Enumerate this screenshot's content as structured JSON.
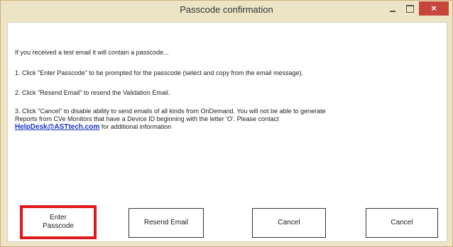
{
  "window": {
    "title": "Passcode confirmation",
    "close_glyph": "×"
  },
  "message": {
    "intro": "If you received a test email it will contain a passcode...",
    "step1": "1. Click \"Enter Passcode\" to be prompted for the passcode (select and copy from the email message).",
    "step2": "2. Click \"Resend Email\" to resend the Validation Email.",
    "step3_line1": "3. Click \"Cancel\" to disable ability to send emails of all kinds from OnDemand. You will not be able to generate",
    "step3_line2": "Reports from CVe Monitors that have a Device ID beginning with the letter 'O'. Please contact",
    "email_link": "HelpDesk@ASTtech.com",
    "step3_line3": " for additional information"
  },
  "buttons": {
    "enter_passcode_line1": "Enter",
    "enter_passcode_line2": "Passcode",
    "resend_email": "Resend Email",
    "cancel_1": "Cancel",
    "cancel_2": "Cancel"
  },
  "colors": {
    "frame": "#ede4c6",
    "close_button": "#c7463c",
    "highlight_box": "#e0181c",
    "link": "#1a33c4"
  }
}
